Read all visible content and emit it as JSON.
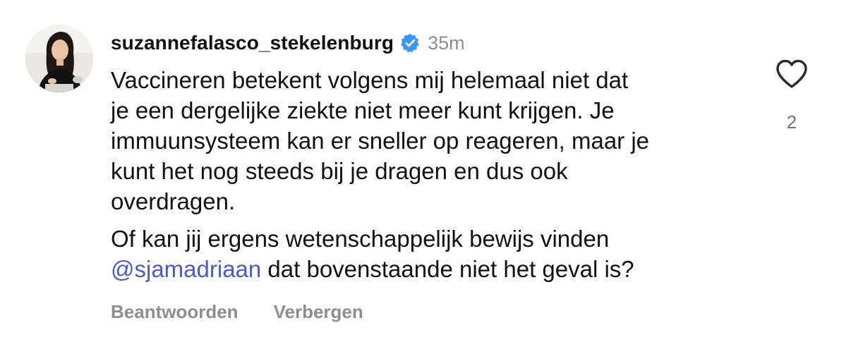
{
  "comment": {
    "username": "suzannefalasco_stekelenburg",
    "verified": true,
    "timestamp": "35m",
    "paragraph_1_lines": [
      "Vaccineren betekent volgens mij helemaal niet dat",
      "je een dergelijke ziekte niet meer kunt krijgen. Je",
      "immuunsysteem kan er sneller op reageren, maar je",
      "kunt het nog steeds bij je dragen en dus ook",
      "overdragen."
    ],
    "paragraph_2": {
      "line_1": "Of kan jij ergens wetenschappelijk bewijs vinden",
      "mention": "@sjamadriaan",
      "line_2_rest": " dat bovenstaande niet het geval is?"
    },
    "reply_label": "Beantwoorden",
    "hide_label": "Verbergen",
    "like_count": "2"
  },
  "colors": {
    "mention": "#4a5bc9",
    "verified_badge": "#3897f0",
    "secondary_text": "#8e8e8e"
  },
  "icons": {
    "avatar": "avatar",
    "verified": "verified-badge-icon",
    "like": "heart-outline-icon"
  }
}
